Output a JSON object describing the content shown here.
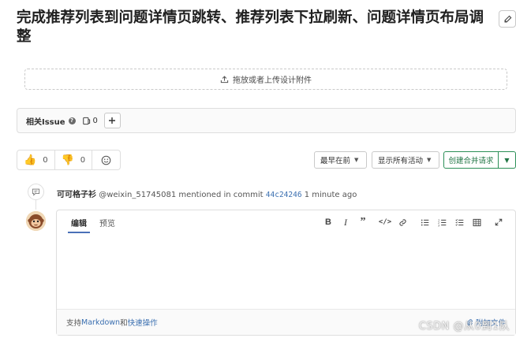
{
  "issue": {
    "title": "完成推荐列表到问题详情页跳转、推荐列表下拉刷新、问题详情页布局调整"
  },
  "upload": {
    "label": "拖放或者上传设计附件"
  },
  "related": {
    "label": "相关Issue",
    "count": "0"
  },
  "awards": {
    "thumbs_up": {
      "emoji": "👍",
      "count": "0"
    },
    "thumbs_down": {
      "emoji": "👎",
      "count": "0"
    }
  },
  "sort": {
    "order": "最早在前",
    "filter": "显示所有活动"
  },
  "merge_request": {
    "label": "创建合并请求"
  },
  "note": {
    "author": "可可格子衫",
    "handle": "@weixin_51745081",
    "action": "mentioned in commit",
    "commit": "44c24246",
    "time": "1 minute ago"
  },
  "editor": {
    "tabs": [
      "编辑",
      "预览"
    ],
    "footer": {
      "prefix": "支持",
      "markdown": "Markdown",
      "and": "和",
      "quick": "快速操作",
      "attach": "附加文件"
    }
  },
  "watermark": "CSDN @从0到1队",
  "colors": {
    "accent": "#4a70b8",
    "merge_green": "#217645",
    "link": "#3a6fb0"
  },
  "icons": [
    "pencil-icon",
    "upload-icon",
    "help-icon",
    "issues-icon",
    "plus-icon",
    "smile-icon",
    "chevron-down-icon",
    "comment-icon",
    "bold-icon",
    "italic-icon",
    "quote-icon",
    "code-icon",
    "link-icon",
    "bullet-list-icon",
    "numbered-list-icon",
    "task-list-icon",
    "table-icon",
    "fullscreen-icon",
    "paperclip-icon"
  ]
}
